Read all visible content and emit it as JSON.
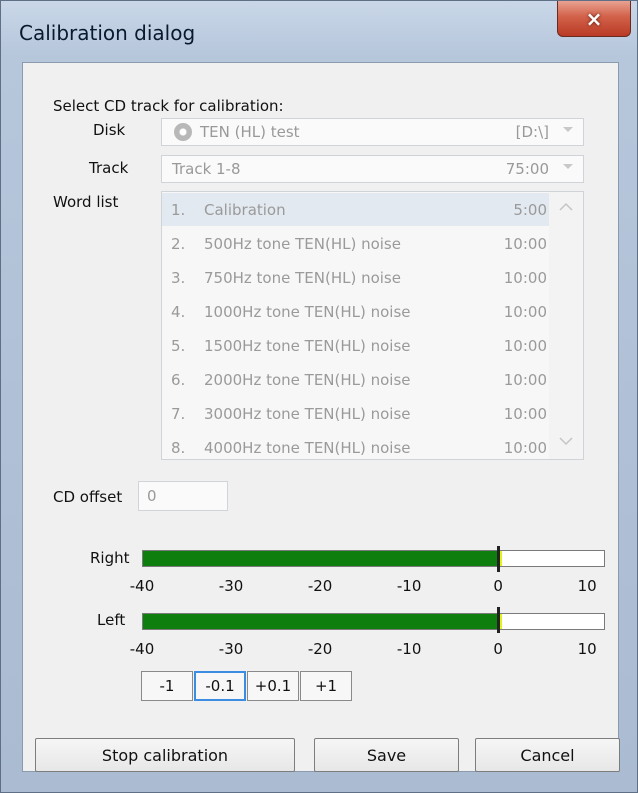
{
  "window": {
    "title": "Calibration dialog",
    "close_icon": "×"
  },
  "calibration": {
    "heading": "Select CD track for calibration:",
    "disk_label": "Disk",
    "disk_value": "TEN (HL) test",
    "disk_drive": "[D:\\]",
    "track_label": "Track",
    "track_value": "Track 1-8",
    "track_duration": "75:00",
    "wordlist_label": "Word list",
    "word_list": [
      {
        "num": "1.",
        "name": "Calibration",
        "dur": "5:00"
      },
      {
        "num": "2.",
        "name": "500Hz tone TEN(HL) noise",
        "dur": "10:00"
      },
      {
        "num": "3.",
        "name": "750Hz tone TEN(HL) noise",
        "dur": "10:00"
      },
      {
        "num": "4.",
        "name": "1000Hz tone TEN(HL) noise",
        "dur": "10:00"
      },
      {
        "num": "5.",
        "name": "1500Hz tone TEN(HL) noise",
        "dur": "10:00"
      },
      {
        "num": "6.",
        "name": "2000Hz tone TEN(HL) noise",
        "dur": "10:00"
      },
      {
        "num": "7.",
        "name": "3000Hz tone TEN(HL) noise",
        "dur": "10:00"
      },
      {
        "num": "8.",
        "name": "4000Hz tone TEN(HL) noise",
        "dur": "10:00"
      }
    ],
    "offset_label": "CD offset",
    "offset_value": "0"
  },
  "meters": {
    "scale_ticks": [
      "-40",
      "-30",
      "-20",
      "-10",
      "0",
      "10"
    ],
    "right": {
      "label": "Right",
      "level_db": 0
    },
    "left": {
      "label": "Left",
      "level_db": 0
    },
    "range_db": [
      -40,
      12
    ]
  },
  "steps": {
    "minus1": "-1",
    "minus01": "-0.1",
    "plus01": "+0.1",
    "plus1": "+1"
  },
  "footer": {
    "stop": "Stop calibration",
    "save": "Save",
    "cancel": "Cancel"
  }
}
